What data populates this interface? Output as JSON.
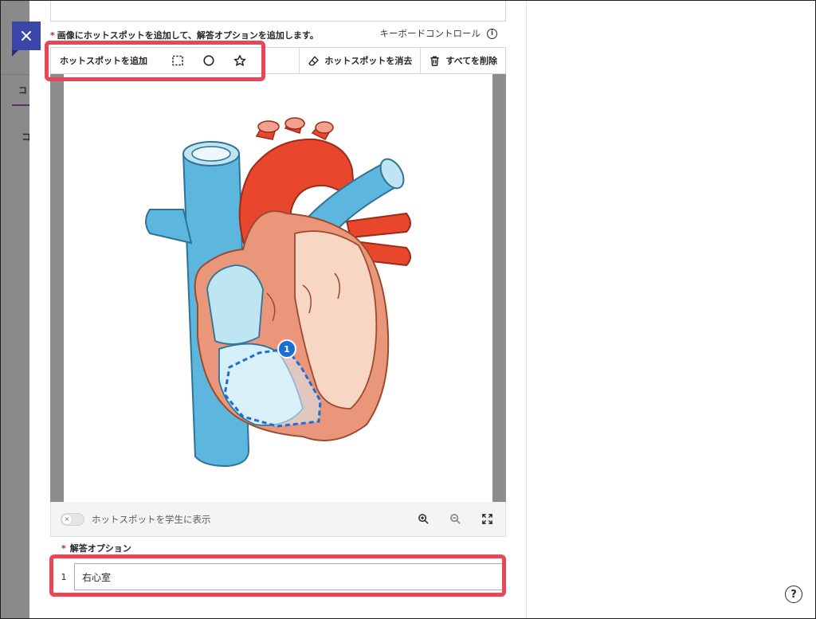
{
  "page": {
    "instruction": "画像にホットスポットを追加して、解答オプションを追加します。",
    "required_mark": "*",
    "keyboard_control": "キーボードコントロール",
    "info_glyph": "i"
  },
  "toolbar": {
    "add_hotspot_label": "ホットスポットを追加",
    "tools": [
      {
        "name": "rectangle-tool",
        "icon": "dashed-rectangle-icon"
      },
      {
        "name": "circle-tool",
        "icon": "circle-icon"
      },
      {
        "name": "polygon-tool",
        "icon": "polygon-icon"
      }
    ],
    "erase_label": "ホットスポットを消去",
    "delete_all_label": "すべてを削除"
  },
  "canvas": {
    "image": "heart-diagram",
    "hotspots": [
      {
        "number": "1",
        "shape": "polygon",
        "stroke_color": "#1a6fd6"
      }
    ]
  },
  "below_canvas": {
    "toggle_label": "ホットスポットを学生に表示",
    "toggle_state": "off",
    "toggle_glyph": "×",
    "zoom_icons": [
      "zoom-in-icon",
      "zoom-out-icon",
      "fullscreen-icon"
    ]
  },
  "answer_options": {
    "label": "解答オプション",
    "items": [
      {
        "number": "1",
        "value": "右心室"
      }
    ]
  },
  "background": {
    "tab_char": "コ",
    "heading_char": "コ"
  },
  "help": {
    "glyph": "?"
  },
  "colors": {
    "accent": "#3b47a8",
    "highlight": "#e8475a",
    "required": "#c8232c",
    "artery": "#e8472e",
    "vein": "#5cb6dd",
    "muscle": "#e9967a",
    "hotspot": "#1a6fd6"
  }
}
